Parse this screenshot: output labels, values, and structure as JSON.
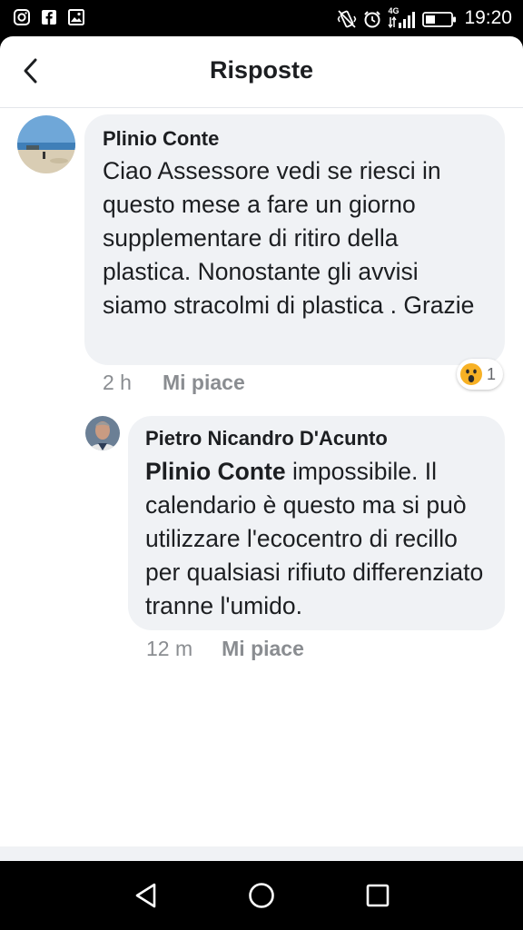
{
  "status_bar": {
    "time": "19:20",
    "network": "4G",
    "left_icons": [
      "instagram-icon",
      "facebook-icon",
      "gallery-icon"
    ],
    "right_icons": [
      "vibrate-icon",
      "alarm-icon",
      "signal-icon",
      "battery-icon"
    ]
  },
  "header": {
    "title": "Risposte",
    "back_icon": "back-arrow-icon"
  },
  "comments": [
    {
      "author": "Plinio Conte",
      "text": "Ciao Assessore vedi se riesci in questo mese a fare un giorno supplementare di ritiro della plastica. Nonostante gli avvisi siamo stracolmi di plastica . Grazie",
      "time": "2 h",
      "like_label": "Mi piace",
      "reaction": {
        "icon": "wow-emoji-icon",
        "count": "1"
      }
    },
    {
      "author": "Pietro Nicandro D'Acunto",
      "mention": "Plinio Conte",
      "text": " impossibile. Il calendario è questo ma si può utilizzare l'ecocentro di recillo per qualsiasi rifiuto differenziato tranne l'umido.",
      "time": "12 m",
      "like_label": "Mi piace"
    }
  ],
  "nav_bar": {
    "icons": [
      "back-triangle-icon",
      "home-circle-icon",
      "recents-square-icon"
    ]
  }
}
